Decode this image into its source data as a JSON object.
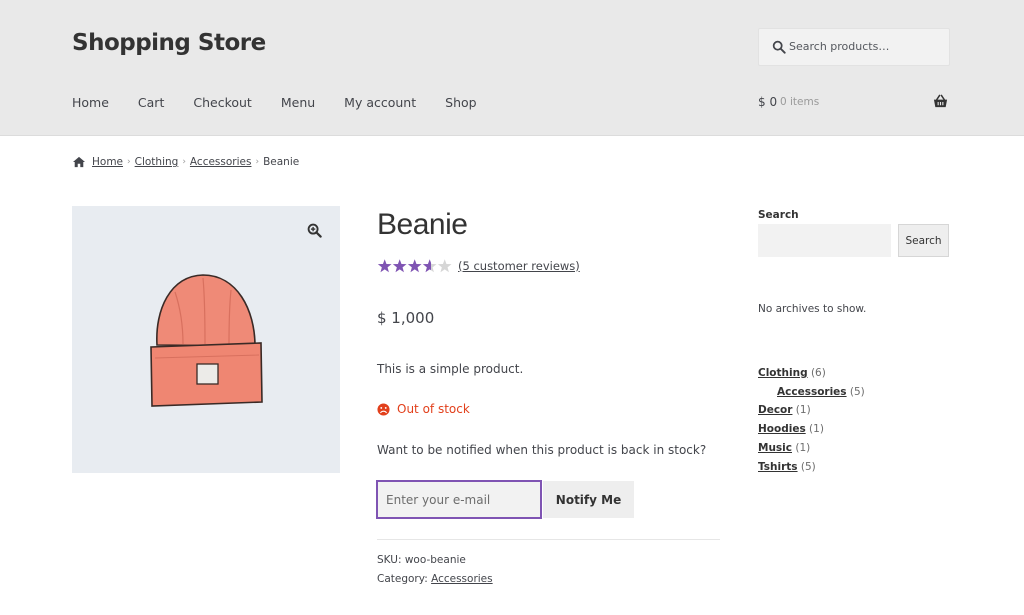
{
  "header": {
    "site_title": "Shopping Store",
    "search_placeholder": "Search products…",
    "nav": [
      "Home",
      "Cart",
      "Checkout",
      "Menu",
      "My account",
      "Shop"
    ],
    "cart_amount": "$ 0",
    "cart_count": "0 items"
  },
  "breadcrumb": {
    "home": "Home",
    "clothing": "Clothing",
    "accessories": "Accessories",
    "current": "Beanie",
    "separator": "›"
  },
  "product": {
    "title": "Beanie",
    "rating_value": 3.6,
    "rating_max": 5,
    "reviews_link": "(5 customer reviews)",
    "price": "$ 1,000",
    "short_description": "This is a simple product.",
    "stock_status": "Out of stock",
    "notify_prompt": "Want to be notified when this product is back in stock?",
    "email_placeholder": "Enter your e-mail",
    "notify_button": "Notify Me",
    "sku_label": "SKU: ",
    "sku_value": "woo-beanie",
    "category_label": "Category: ",
    "category_value": "Accessories"
  },
  "sidebar": {
    "search_label": "Search",
    "search_button": "Search",
    "no_archives": "No archives to show.",
    "categories": [
      {
        "name": "Clothing",
        "count": "(6)",
        "sub": false
      },
      {
        "name": "Accessories",
        "count": "(5)",
        "sub": true
      },
      {
        "name": "Decor",
        "count": "(1)",
        "sub": false
      },
      {
        "name": "Hoodies",
        "count": "(1)",
        "sub": false
      },
      {
        "name": "Music",
        "count": "(1)",
        "sub": false
      },
      {
        "name": "Tshirts",
        "count": "(5)",
        "sub": false
      }
    ]
  },
  "colors": {
    "accent": "#7f54b3",
    "out_of_stock": "#e2401c",
    "header_bg": "#e9e9e9"
  },
  "icons": [
    "search-icon",
    "basket-icon",
    "home-icon",
    "zoom-icon",
    "star-icon",
    "sad-face-icon"
  ]
}
